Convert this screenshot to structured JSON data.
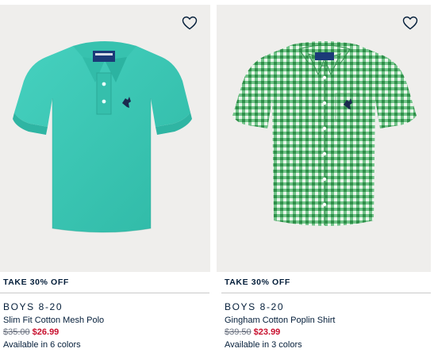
{
  "products": [
    {
      "promo": "TAKE 30% OFF",
      "brand": "BOYS 8-20",
      "name": "Slim Fit Cotton Mesh Polo",
      "old_price": "$35.00",
      "sale_price": "$26.99",
      "availability": "Available in 6 colors",
      "image_icon": "teal-polo-shirt",
      "color": "#3cc9b6"
    },
    {
      "promo": "TAKE 30% OFF",
      "brand": "BOYS 8-20",
      "name": "Gingham Cotton Poplin Shirt",
      "old_price": "$39.50",
      "sale_price": "$23.99",
      "availability": "Available in 3 colors",
      "image_icon": "green-gingham-shirt",
      "color": "#3aa55a"
    }
  ],
  "favorite_icon": "heart-outline-icon",
  "sale_color": "#c8102e"
}
